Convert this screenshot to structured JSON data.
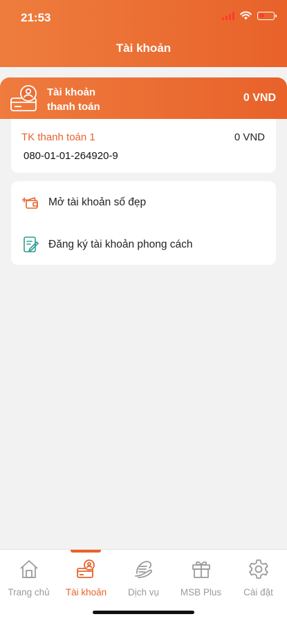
{
  "status_bar": {
    "time": "21:53"
  },
  "header": {
    "title": "Tài khoản"
  },
  "account_group": {
    "label_line1": "Tài khoản",
    "label_line2": "thanh toán",
    "total": "0 VND"
  },
  "account": {
    "name": "TK thanh toán 1",
    "balance": "0 VND",
    "number": "080-01-01-264920-9"
  },
  "options": [
    {
      "label": "Mở tài khoản số đẹp",
      "icon": "wallet-plus-icon"
    },
    {
      "label": "Đăng ký tài khoản phong cách",
      "icon": "document-edit-icon"
    }
  ],
  "tabs": [
    {
      "label": "Trang chủ",
      "icon": "home-icon",
      "active": false
    },
    {
      "label": "Tài khoản",
      "icon": "account-card-icon",
      "active": true
    },
    {
      "label": "Dịch vụ",
      "icon": "services-icon",
      "active": false
    },
    {
      "label": "MSB Plus",
      "icon": "gift-icon",
      "active": false
    },
    {
      "label": "Cài đặt",
      "icon": "gear-icon",
      "active": false
    }
  ],
  "colors": {
    "accent": "#e8622a",
    "background": "#f2f2f2"
  }
}
